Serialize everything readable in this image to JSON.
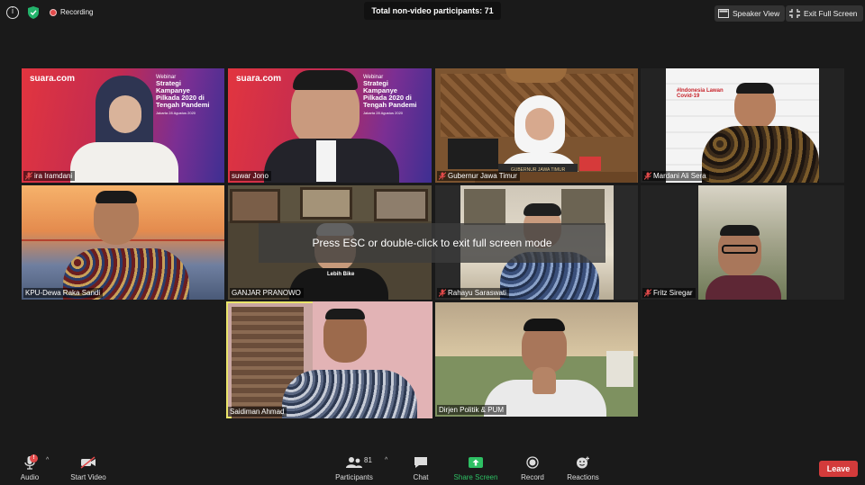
{
  "topbar": {
    "recording_label": "Recording",
    "participants_pill": "Total non-video participants: 71",
    "speaker_view_label": "Speaker View",
    "exit_fullscreen_label": "Exit Full Screen"
  },
  "slide": {
    "brand": "suara.com",
    "webinar": "Webinar",
    "title": "Strategi Kampanye Pilkada 2020 di Tengah Pandemi",
    "date_line": "Jakarta 28 Agustus 2020"
  },
  "tiles": [
    {
      "name": "ira Iramdani",
      "muted": true
    },
    {
      "name": "suwar Jono",
      "muted": false
    },
    {
      "name": "Gubernur Jawa Timur",
      "muted": true,
      "nameplate": "GUBERNUR JAWA TIMUR"
    },
    {
      "name": "Mardani Ali Sera",
      "muted": true,
      "banner": "#Indonesia Lawan Covid-19"
    },
    {
      "name": "KPU-Dewa Raka Sandi",
      "muted": false
    },
    {
      "name": "GANJAR PRANOWO",
      "muted": false,
      "shirt_text": "Lebih Bike"
    },
    {
      "name": "Rahayu Saraswati",
      "muted": true
    },
    {
      "name": "Fritz Siregar",
      "muted": true
    },
    {
      "name": "Saidiman Ahmad",
      "muted": false,
      "active": true
    },
    {
      "name": "Dirjen Politik & PUM",
      "muted": false
    }
  ],
  "toast": "Press ESC or double-click to exit full screen mode",
  "toolbar": {
    "audio_label": "Audio",
    "audio_badge": "!",
    "start_video_label": "Start Video",
    "participants_label": "Participants",
    "participants_count": "81",
    "chat_label": "Chat",
    "share_screen_label": "Share Screen",
    "record_label": "Record",
    "reactions_label": "Reactions",
    "leave_label": "Leave"
  },
  "colors": {
    "active_speaker_border": "#e9e46a",
    "share_green": "#2ec064",
    "leave_red": "#d33b3b",
    "recording_red": "#e24a4a"
  }
}
